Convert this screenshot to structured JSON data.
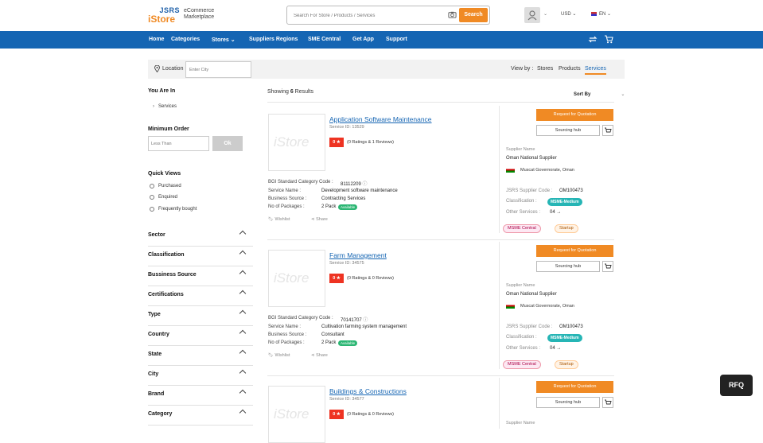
{
  "header": {
    "logo_top": "JSRS",
    "logo_bottom": "iStore",
    "tagline": "eCommerce Marketplace",
    "search_placeholder": "Search For Store / Products / Services",
    "search_button": "Search",
    "currency": "USD",
    "language": "EN"
  },
  "nav": {
    "items": [
      "Home",
      "Categories",
      "Stores",
      "Suppliers Regions",
      "SME Central",
      "Get App",
      "Support"
    ]
  },
  "locbar": {
    "label": "Location",
    "placeholder": "Enter City",
    "viewby_label": "View by :",
    "options": [
      "Stores",
      "Products",
      "Services"
    ],
    "active": "Services"
  },
  "sidebar": {
    "you_are_in": "You Are In",
    "crumb": "Services",
    "min_order": "Minimum Order",
    "min_placeholder": "Less Than",
    "ok": "Ok",
    "quick_views": "Quick Views",
    "quick_options": [
      "Purchased",
      "Enquired",
      "Frequently bought"
    ],
    "filters": [
      "Sector",
      "Classification",
      "Bussiness Source",
      "Certifications",
      "Type",
      "Country",
      "State",
      "City",
      "Brand",
      "Category"
    ]
  },
  "results": {
    "showing_prefix": "Showing",
    "count": "6",
    "showing_suffix": "Results",
    "sort": "Sort By"
  },
  "labels": {
    "rating_badge": "0 ★",
    "bgi": "BGI Standard Category Code :",
    "service_name": "Service Name :",
    "business_source": "Business Source :",
    "packages": "No of Packages :",
    "available": "Available",
    "wishlist": "Wishlist",
    "share": "Share",
    "rfq_button": "Request for Quotation",
    "sourcing": "Sourcing hub",
    "supplier_name": "Supplier Name",
    "supplier_code": "JSRS Supplier Code :",
    "classification": "Classification :",
    "other_services": "Other Services :",
    "msme_badge": "MSME-Medium",
    "msme_central": "MSME Central",
    "startup": "Startup",
    "logo_placeholder": "iStore"
  },
  "cards": [
    {
      "title": "Application Software Maintenance",
      "service_id": "Service ID: 13529",
      "ratings": "(0 Ratings & 1 Reviews)",
      "bgi_code": "81112209",
      "service_name": "Development software maintenance",
      "business_source": "Contracting Services",
      "packages": "2 Pack",
      "supplier": "Oman National Supplier",
      "location": "Muscat Governorate, Oman",
      "supplier_code": "OM100473",
      "other_services": "04 →"
    },
    {
      "title": "Farm Management",
      "service_id": "Service ID: 34575",
      "ratings": "(0 Ratings & 0 Reviews)",
      "bgi_code": "70141707",
      "service_name": "Cultivation farming system management",
      "business_source": "Consultant",
      "packages": "2 Pack",
      "supplier": "Oman National Supplier",
      "location": "Muscat Governorate, Oman",
      "supplier_code": "OM100473",
      "other_services": "04 →"
    },
    {
      "title": "Buildings & Constructions",
      "service_id": "Service ID: 34577",
      "ratings": "(0 Ratings & 0 Reviews)"
    }
  ],
  "rfq_float": "RFQ",
  "colors": {
    "brand_blue": "#1565b3",
    "accent_orange": "#f08a24"
  }
}
